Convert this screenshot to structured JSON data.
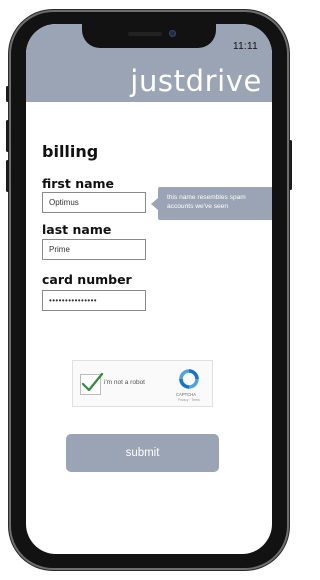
{
  "status_bar": {
    "time": "11:11"
  },
  "header": {
    "brand": "justdrive"
  },
  "billing": {
    "title": "billing",
    "first_name": {
      "label": "first name",
      "value": "Optimus"
    },
    "last_name": {
      "label": "last name",
      "value": "Prime"
    },
    "card_number": {
      "label": "card number",
      "value": "•••••••••••••••"
    },
    "warning": "this name resembles spam accounts we've seen"
  },
  "captcha": {
    "label": "i'm not a robot",
    "brand": "CAPTCHA",
    "subtext": "Privacy · Terms",
    "checked": true,
    "check_color": "#2e8b3a",
    "logo_colors": [
      "#1a73c4",
      "#4fa3e0"
    ]
  },
  "submit": {
    "label": "submit"
  },
  "colors": {
    "accent": "#9aa4b5",
    "frame": "#121212"
  }
}
